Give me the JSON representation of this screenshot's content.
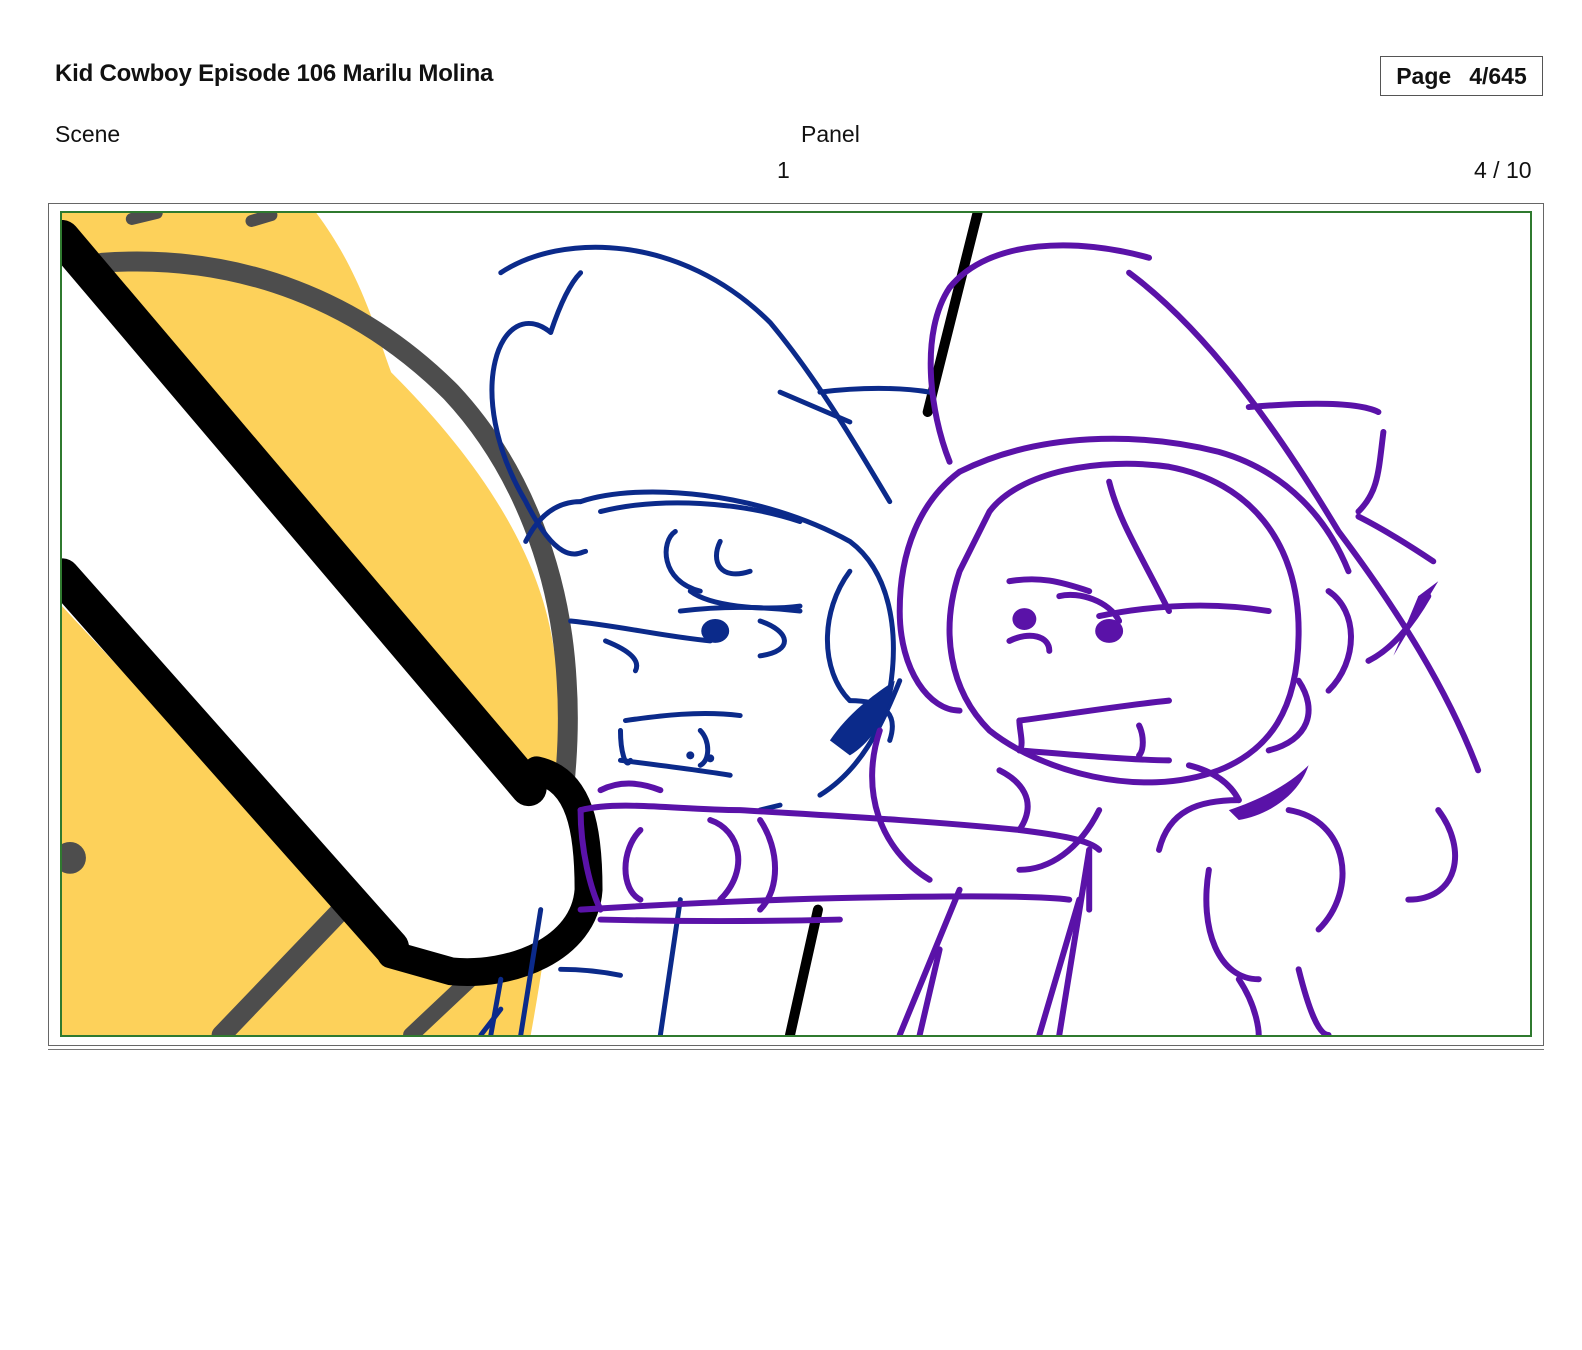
{
  "header": {
    "title": "Kid Cowboy Episode 106 Marilu Molina",
    "page_label": "Page",
    "page_value": "4/645"
  },
  "columns": {
    "scene_label": "Scene",
    "panel_label": "Panel",
    "scene_value": "1",
    "panel_value": "4 / 10"
  },
  "panel": {
    "border_color": "#2f7a2f",
    "sketch_colors": {
      "yellow": "#fdd15a",
      "gray": "#4d4d4d",
      "black": "#000000",
      "navy": "#0b2a8a",
      "purple": "#5a12a8"
    }
  }
}
